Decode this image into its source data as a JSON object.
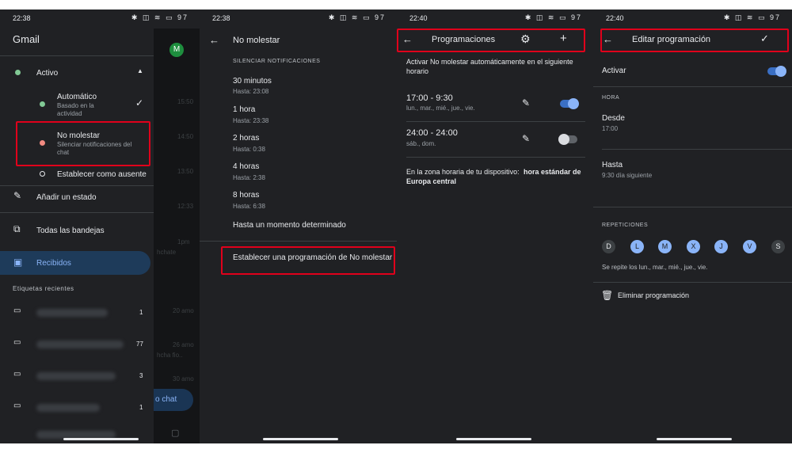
{
  "panel1": {
    "status_time": "22:38",
    "status_icons": "✱ ◫ ≋ ▭ 97",
    "app_title": "Gmail",
    "avatar_letter": "M",
    "active_label": "Activo",
    "auto_label": "Automático",
    "auto_sub": "Basado en la actividad",
    "dnd_label": "No molestar",
    "dnd_sub": "Silenciar notificaciones del chat",
    "away_label": "Establecer como ausente",
    "add_status": "Añadir un estado",
    "all_inboxes": "Todas las bandejas",
    "received": "Recibidos",
    "recent_labels": "Etiquetas recientes",
    "label_counts": [
      "1",
      "77",
      "3",
      "1"
    ],
    "scrim_texts": [
      "15:50",
      "14:50",
      "13:50",
      "12:33",
      "1pm",
      "hchate",
      "20 amo",
      "26 amo",
      "hcha fio..",
      "30 amo",
      "o chat"
    ]
  },
  "panel2": {
    "status_time": "22:38",
    "status_icons": "✱ ◫ ≋ ▭ 97",
    "title": "No molestar",
    "section": "Silenciar notificaciones",
    "options": [
      {
        "label": "30 minutos",
        "sub": "Hasta: 23:08"
      },
      {
        "label": "1 hora",
        "sub": "Hasta: 23:38"
      },
      {
        "label": "2 horas",
        "sub": "Hasta: 0:38"
      },
      {
        "label": "4 horas",
        "sub": "Hasta: 2:38"
      },
      {
        "label": "8 horas",
        "sub": "Hasta: 6:38"
      }
    ],
    "until_moment": "Hasta un momento determinado",
    "schedule_link": "Establecer una programación de No molestar"
  },
  "panel3": {
    "status_time": "22:40",
    "status_icons": "✱ ◫ ≋ ▭ 97",
    "title": "Programaciones",
    "intro_1": "Activar No molestar automáticamente en el siguiente",
    "intro_2": "horario",
    "schedules": [
      {
        "time": "17:00 - 9:30",
        "days": "lun., mar., mié., jue., vie.",
        "enabled": true
      },
      {
        "time": "24:00 - 24:00",
        "days": "sáb., dom.",
        "enabled": false
      }
    ],
    "tz_prefix": "En la zona horaria de tu dispositivo:",
    "tz_bold_1": "hora estándar de",
    "tz_bold_2": "Europa central"
  },
  "panel4": {
    "status_time": "22:40",
    "status_icons": "✱ ◫ ≋ ▭ 97",
    "title": "Editar programación",
    "activate": "Activar",
    "hour_section": "Hora",
    "from_label": "Desde",
    "from_value": "17:00",
    "to_label": "Hasta",
    "to_value": "9:30 día siguiente",
    "repeat_section": "Repeticiones",
    "days": [
      {
        "letter": "D",
        "on": false
      },
      {
        "letter": "L",
        "on": true
      },
      {
        "letter": "M",
        "on": true
      },
      {
        "letter": "X",
        "on": true
      },
      {
        "letter": "J",
        "on": true
      },
      {
        "letter": "V",
        "on": true
      },
      {
        "letter": "S",
        "on": false
      }
    ],
    "repeat_summary": "Se repite los lun., mar., mié., jue., vie.",
    "delete": "Eliminar programación"
  },
  "colors": {
    "background": "#202124",
    "accent": "#8ab4f8",
    "highlight": "#e0001b",
    "active_dot": "#81c995",
    "dnd_dot": "#f28b82"
  }
}
